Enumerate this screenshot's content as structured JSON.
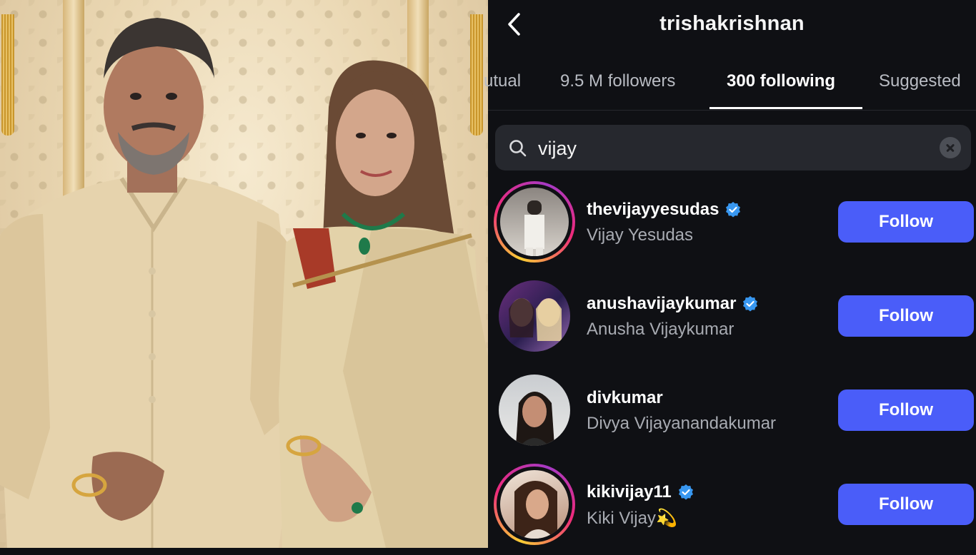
{
  "profile": {
    "username": "trishakrishnan"
  },
  "tabs": [
    {
      "label": "utual",
      "active": false
    },
    {
      "label": "9.5 M followers",
      "active": false
    },
    {
      "label": "300 following",
      "active": true
    },
    {
      "label": "Suggested",
      "active": false
    }
  ],
  "search": {
    "value": "vijay",
    "icon": "search-icon"
  },
  "following": [
    {
      "username": "thevijayyesudas",
      "full_name": "Vijay Yesudas",
      "verified": true,
      "story_ring": true,
      "button": "Follow"
    },
    {
      "username": "anushavijaykumar",
      "full_name": "Anusha Vijaykumar",
      "verified": true,
      "story_ring": false,
      "button": "Follow"
    },
    {
      "username": "divkumar",
      "full_name": "Divya Vijayanandakumar",
      "verified": false,
      "story_ring": false,
      "button": "Follow"
    },
    {
      "username": "kikivijay11",
      "full_name": "Kiki Vijay",
      "name_emoji": "💫",
      "verified": true,
      "story_ring": true,
      "button": "Follow"
    }
  ],
  "colors": {
    "background": "#0f1014",
    "follow_button": "#4a5df9",
    "verified_badge": "#3897f0"
  }
}
